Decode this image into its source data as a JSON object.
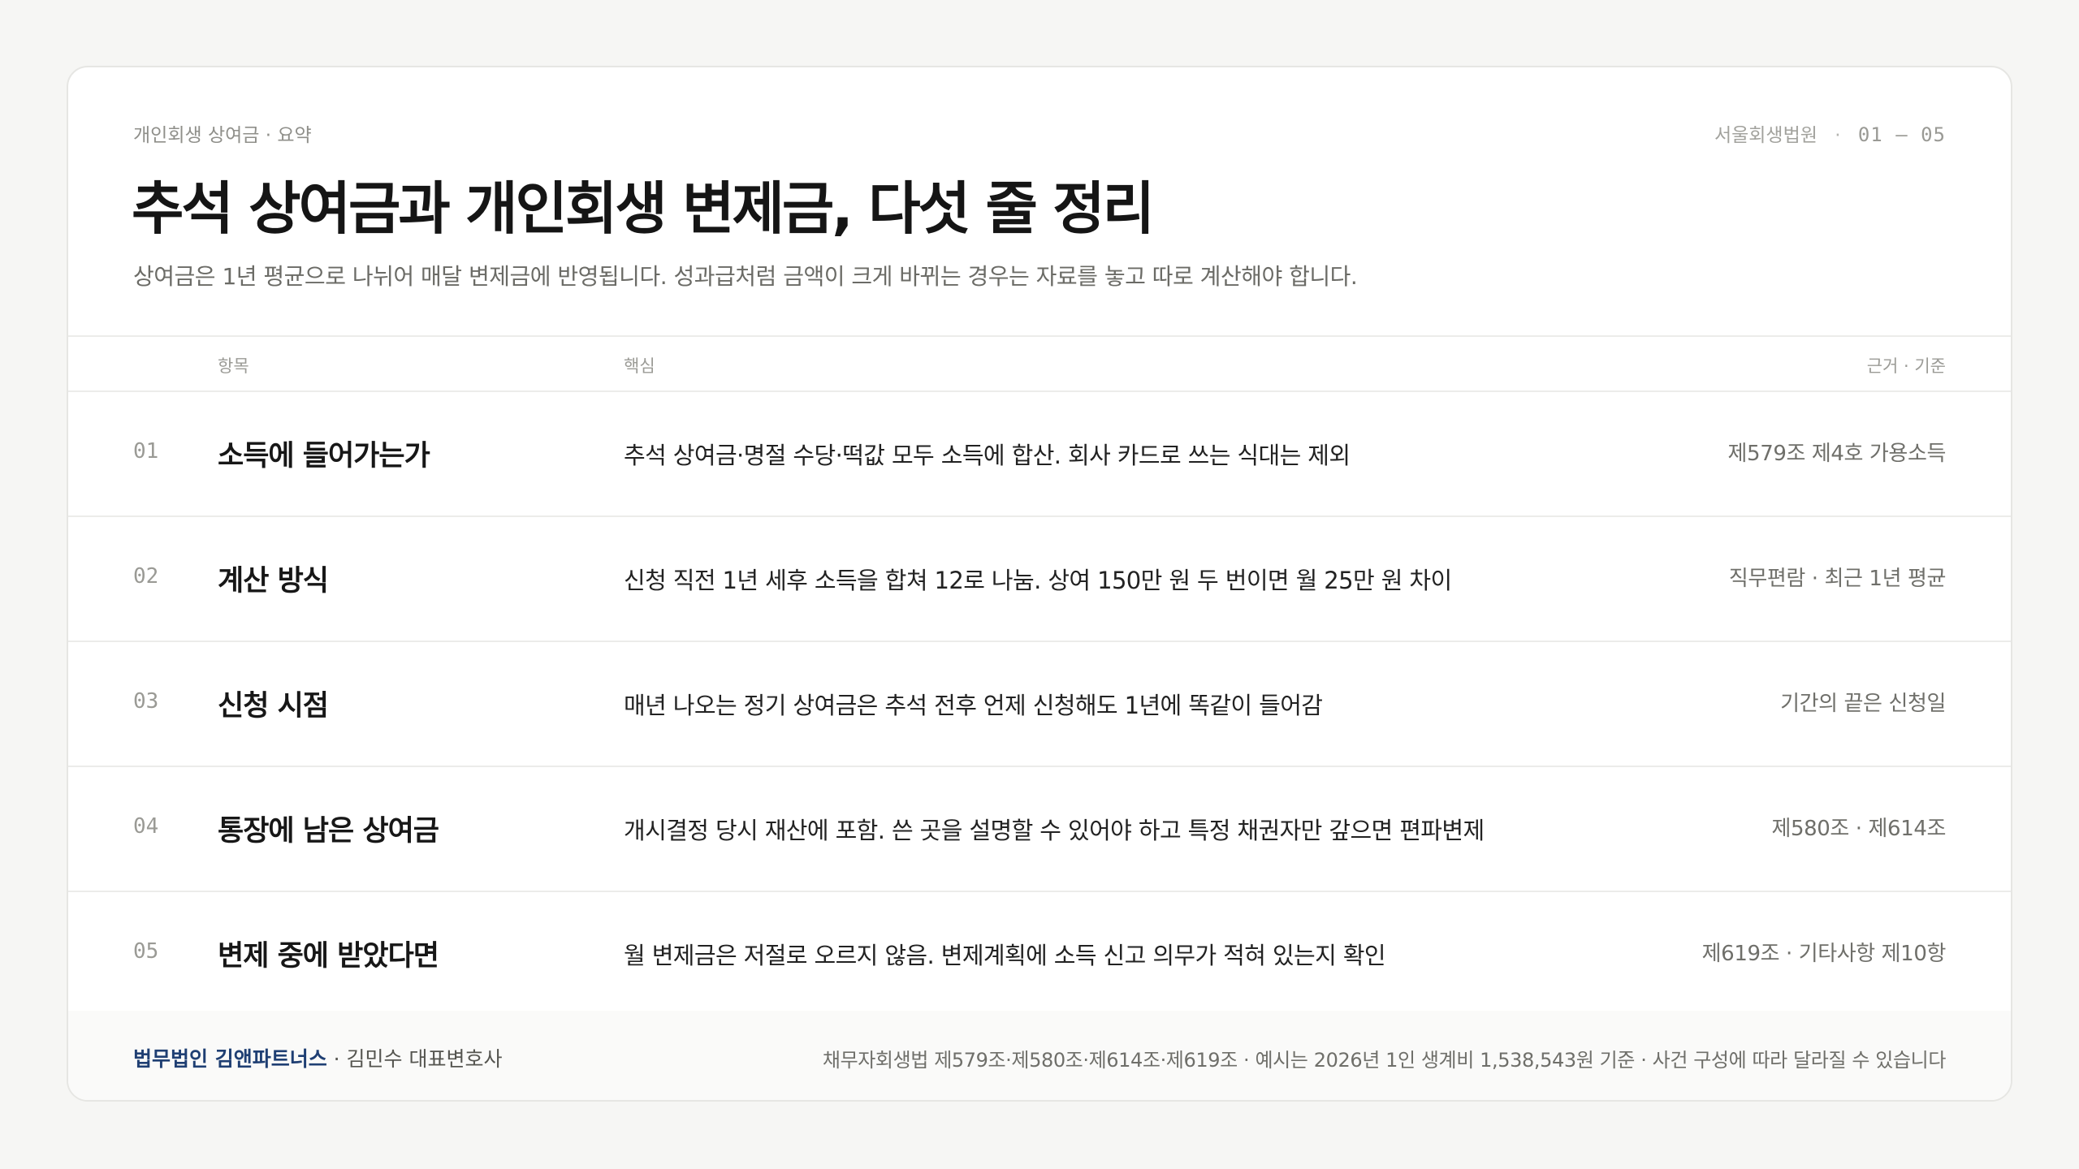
{
  "header": {
    "kicker": "개인회생 상여금 · 요약",
    "court": "서울회생법원",
    "range_separator": "·",
    "range": "01 — 05",
    "title": "추석 상여금과 개인회생 변제금, 다섯 줄 정리",
    "subtitle": "상여금은 1년 평균으로 나뉘어 매달 변제금에 반영됩니다. 성과급처럼 금액이 크게 바뀌는 경우는 자료를 놓고 따로 계산해야 합니다."
  },
  "columns": {
    "item": "항목",
    "core": "핵심",
    "basis": "근거 · 기준"
  },
  "rows": [
    {
      "num": "01",
      "item": "소득에 들어가는가",
      "core": "추석 상여금·명절 수당·떡값 모두 소득에 합산. 회사 카드로 쓰는 식대는 제외",
      "basis": "제579조 제4호 가용소득"
    },
    {
      "num": "02",
      "item": "계산 방식",
      "core": "신청 직전 1년 세후 소득을 합쳐 12로 나눔. 상여 150만 원 두 번이면 월 25만 원 차이",
      "basis": "직무편람 · 최근 1년 평균"
    },
    {
      "num": "03",
      "item": "신청 시점",
      "core": "매년 나오는 정기 상여금은 추석 전후 언제 신청해도 1년에 똑같이 들어감",
      "basis": "기간의 끝은 신청일"
    },
    {
      "num": "04",
      "item": "통장에 남은 상여금",
      "core": "개시결정 당시 재산에 포함. 쓴 곳을 설명할 수 있어야 하고 특정 채권자만 갚으면 편파변제",
      "basis": "제580조 · 제614조"
    },
    {
      "num": "05",
      "item": "변제 중에 받았다면",
      "core": "월 변제금은 저절로 오르지 않음. 변제계획에 소득 신고 의무가 적혀 있는지 확인",
      "basis": "제619조 · 기타사항 제10항"
    }
  ],
  "footer": {
    "firm_name": "법무법인 김앤파트너스",
    "attorney": " · 김민수 대표변호사",
    "note": "채무자회생법 제579조·제580조·제614조·제619조 · 예시는 2026년 1인 생계비 1,538,543원 기준 · 사건 구성에 따라 달라질 수 있습니다"
  },
  "colors": {
    "background": "#f6f6f4",
    "card": "#ffffff",
    "accent": "#1f3f73"
  }
}
